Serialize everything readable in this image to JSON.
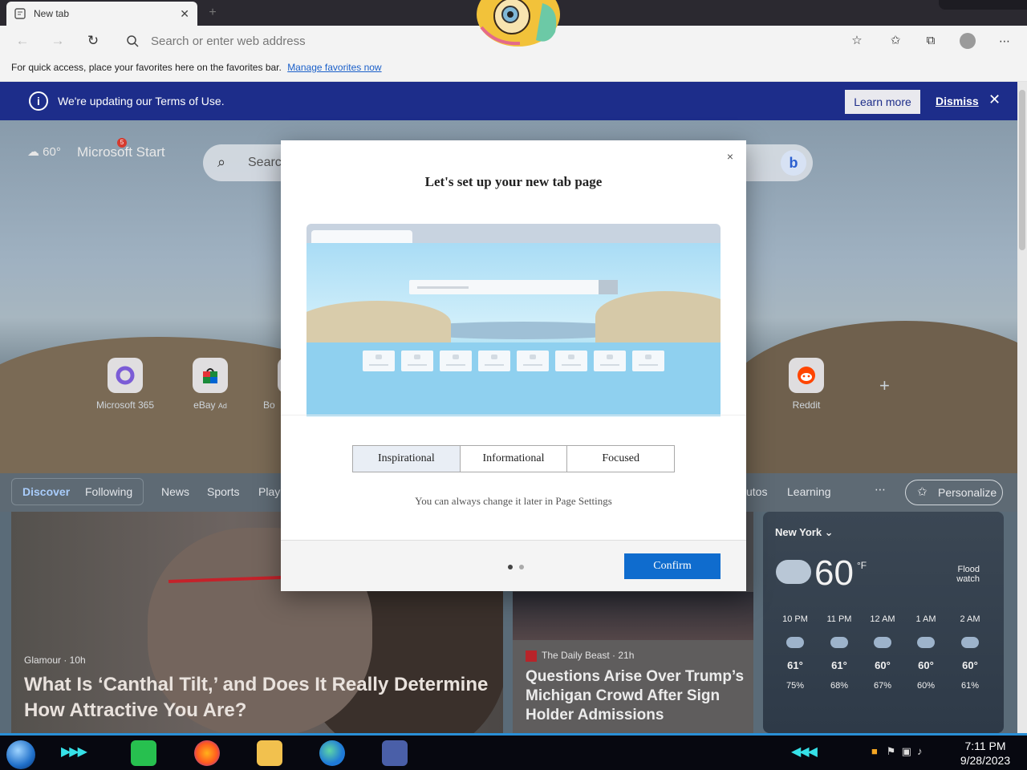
{
  "browser": {
    "tab_title": "New tab",
    "address_placeholder": "Search or enter web address",
    "favorites_prompt": "For quick access, place your favorites here on the favorites bar.",
    "favorites_link": "Manage favorites now"
  },
  "banner": {
    "text": "We're updating our Terms of Use.",
    "learn_more": "Learn more",
    "dismiss": "Dismiss"
  },
  "newtab": {
    "weather_temp": "60°",
    "brand": "Microsoft Start",
    "notification_count": "5",
    "search_placeholder": "Search",
    "quick_links": [
      {
        "label": "Microsoft 365"
      },
      {
        "label": "eBay",
        "badge": "Ad"
      },
      {
        "label": "Bo"
      },
      {
        "label": "Reddit"
      }
    ],
    "feed_tabs": [
      "Discover",
      "Following",
      "News",
      "Sports",
      "Play",
      "utos",
      "Learning"
    ],
    "personalize": "Personalize"
  },
  "cards": {
    "main": {
      "source": "Glamour · 10h",
      "title": "What Is ‘Canthal Tilt,’ and Does It Really Determine How Attractive You Are?"
    },
    "news": {
      "source": "The Daily Beast · 21h",
      "title": "Questions Arise Over Trump’s Michigan Crowd After Sign Holder Admissions"
    }
  },
  "weather_card": {
    "city": "New York",
    "temp": "60",
    "unit": "°F",
    "alert": "Flood watch",
    "hours": [
      {
        "time": "10 PM",
        "temp": "61°",
        "precip": "75%"
      },
      {
        "time": "11 PM",
        "temp": "61°",
        "precip": "68%"
      },
      {
        "time": "12 AM",
        "temp": "60°",
        "precip": "67%"
      },
      {
        "time": "1 AM",
        "temp": "60°",
        "precip": "60%"
      },
      {
        "time": "2 AM",
        "temp": "60°",
        "precip": "61%"
      }
    ]
  },
  "modal": {
    "title": "Let's set up your new tab page",
    "options": [
      "Inspirational",
      "Informational",
      "Focused"
    ],
    "selected_option": "Inspirational",
    "hint": "You can always change it later in Page Settings",
    "confirm": "Confirm",
    "close_glyph": "×",
    "page_indicator": {
      "current": 1,
      "total": 2
    }
  },
  "taskbar": {
    "time": "7:11 PM",
    "date": "9/28/2023"
  },
  "colors": {
    "accent": "#0f6cce",
    "banner": "#1d2d8a",
    "taskbar_accent": "#2a8fd6"
  }
}
